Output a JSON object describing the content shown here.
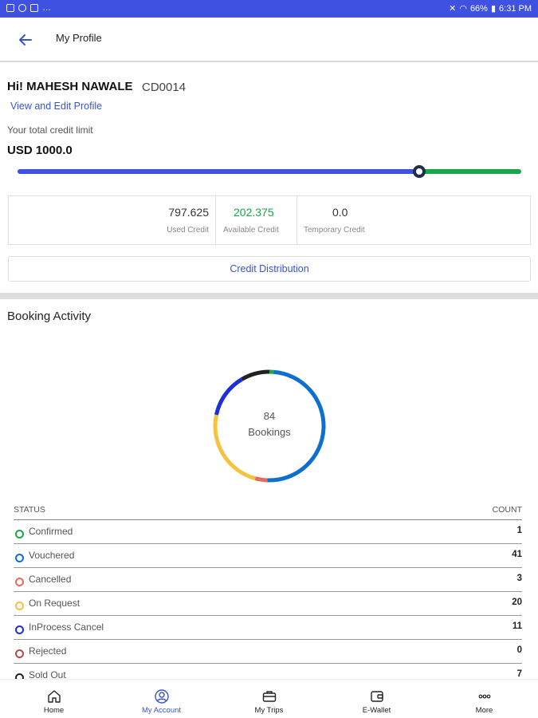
{
  "status_bar": {
    "battery": "66%",
    "time": "6:31 PM"
  },
  "app_bar": {
    "title": "My Profile"
  },
  "profile": {
    "greeting": "Hi! MAHESH NAWALE",
    "code": "CD0014",
    "edit_link": "View and Edit Profile",
    "credit_label": "Your total credit limit",
    "credit_total": "USD 1000.0"
  },
  "credit_bar": {
    "used_fraction": 0.797625,
    "used_color": "#3f51e0",
    "available_color": "#1aa64a"
  },
  "credit_stats": {
    "used": {
      "value": "797.625",
      "label": "Used Credit"
    },
    "available": {
      "value": "202.375",
      "label": "Available Credit"
    },
    "temporary": {
      "value": "0.0",
      "label": "Temporary Credit"
    }
  },
  "distribution_button": "Credit Distribution",
  "booking_activity": {
    "title": "Booking Activity",
    "total": "84",
    "total_label": "Bookings",
    "header_status": "STATUS",
    "header_count": "COUNT",
    "rows": [
      {
        "status": "Confirmed",
        "count": "1",
        "color": "#1aa64a"
      },
      {
        "status": "Vouchered",
        "count": "41",
        "color": "#0f6fd1"
      },
      {
        "status": "Cancelled",
        "count": "3",
        "color": "#e76a5e"
      },
      {
        "status": "On Request",
        "count": "20",
        "color": "#f5c242"
      },
      {
        "status": "InProcess Cancel",
        "count": "11",
        "color": "#1f2fd6"
      },
      {
        "status": "Rejected",
        "count": "0",
        "color": "#b44a4a"
      },
      {
        "status": "Sold Out",
        "count": "7",
        "color": "#222222"
      }
    ]
  },
  "bottom_nav": [
    {
      "label": "Home",
      "icon": "home-icon"
    },
    {
      "label": "My Account",
      "icon": "account-icon",
      "active": true
    },
    {
      "label": "My Trips",
      "icon": "briefcase-icon"
    },
    {
      "label": "E-Wallet",
      "icon": "wallet-icon"
    },
    {
      "label": "More",
      "icon": "more-icon"
    }
  ]
}
